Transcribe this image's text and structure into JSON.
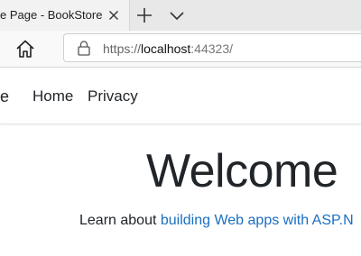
{
  "browser": {
    "tab_title": "e Page - BookStore",
    "address": {
      "scheme": "https://",
      "host": "localhost",
      "port": ":44323/"
    }
  },
  "site": {
    "brand": "e",
    "nav": [
      {
        "label": "Home"
      },
      {
        "label": "Privacy"
      }
    ]
  },
  "main": {
    "heading": "Welcome",
    "lead_prefix": "Learn about ",
    "lead_link": "building Web apps with ASP.N"
  },
  "colors": {
    "link": "#1b6ec2",
    "text": "#212529",
    "tabstrip": "#e8e8e8"
  },
  "icons": {
    "close": "close-icon",
    "new_tab": "plus-icon",
    "tab_menu": "chevron-down-icon",
    "home": "home-icon",
    "lock": "lock-icon"
  }
}
